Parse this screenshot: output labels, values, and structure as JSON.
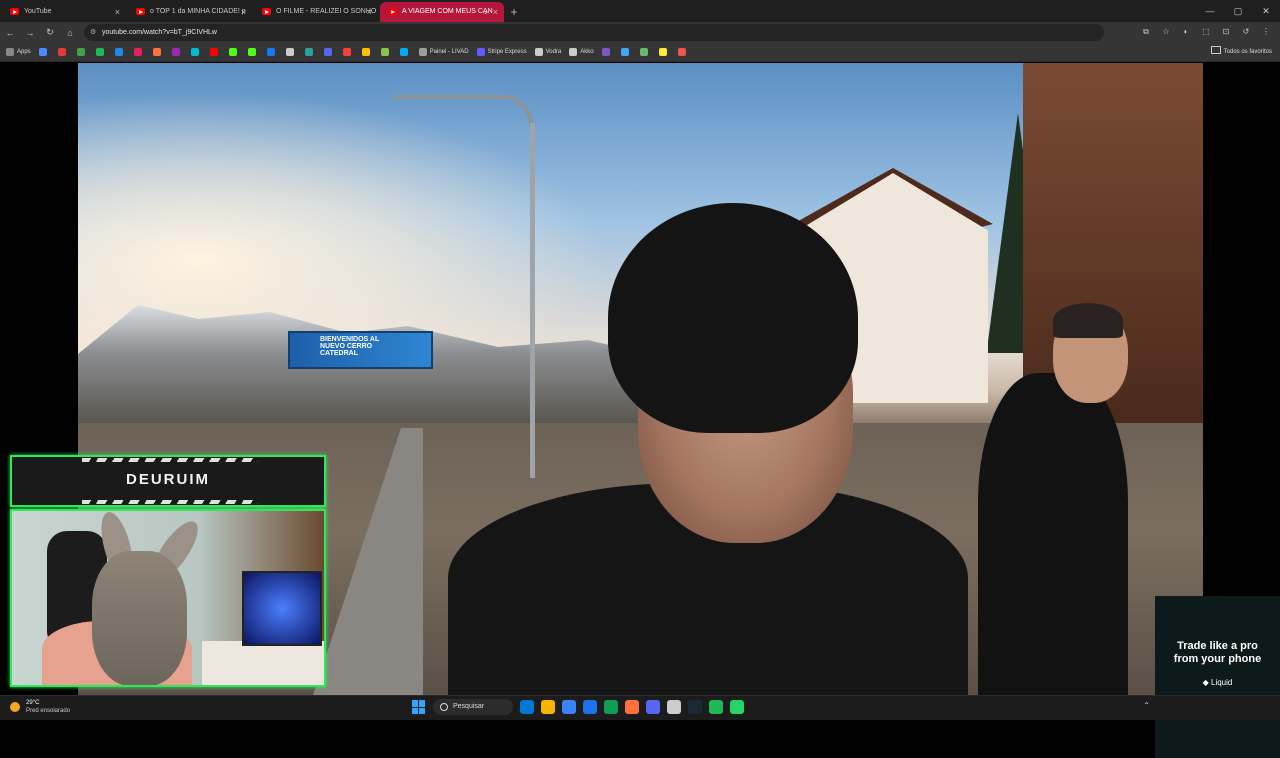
{
  "browser": {
    "tabs": [
      {
        "title": "YouTube",
        "active": false
      },
      {
        "title": "o TOP 1 da MINHA CIDADE! p",
        "active": false
      },
      {
        "title": "O FILME - REALIZEI O SONHO",
        "active": false
      },
      {
        "title": "A VIAGEM COM MEUS CAN",
        "active": true
      }
    ],
    "close_glyph": "×",
    "new_tab_glyph": "+",
    "window_controls": [
      "—",
      "▢",
      "✕"
    ],
    "url": "youtube.com/watch?v=bT_j9CIVHLw",
    "nav": [
      "←",
      "→",
      "↻",
      "⌂"
    ],
    "toolbar_icons": [
      "⧉",
      "☆",
      "◐",
      "⬚",
      "⊡",
      "↺",
      "⋮"
    ],
    "bookmarks": [
      {
        "label": "Apps",
        "color": "#888888"
      },
      {
        "label": "",
        "color": "#4a8cff"
      },
      {
        "label": "",
        "color": "#e53935"
      },
      {
        "label": "",
        "color": "#43a047"
      },
      {
        "label": "",
        "color": "#1db954"
      },
      {
        "label": "",
        "color": "#1e88e5"
      },
      {
        "label": "",
        "color": "#e91e63"
      },
      {
        "label": "",
        "color": "#ff7043"
      },
      {
        "label": "",
        "color": "#9c27b0"
      },
      {
        "label": "",
        "color": "#00bcd4"
      },
      {
        "label": "",
        "color": "#ff0000"
      },
      {
        "label": "",
        "color": "#53fc18"
      },
      {
        "label": "",
        "color": "#53fc18"
      },
      {
        "label": "",
        "color": "#1877f2"
      },
      {
        "label": "",
        "color": "#cccccc"
      },
      {
        "label": "",
        "color": "#26a69a"
      },
      {
        "label": "",
        "color": "#5865f2"
      },
      {
        "label": "",
        "color": "#f44336"
      },
      {
        "label": "",
        "color": "#ffc107"
      },
      {
        "label": "",
        "color": "#8bc34a"
      },
      {
        "label": "",
        "color": "#03a9f4"
      },
      {
        "label": "Painel - LIVAD",
        "color": "#9e9e9e"
      },
      {
        "label": "Stripe Express",
        "color": "#635bff"
      },
      {
        "label": "Vodra",
        "color": "#cccccc"
      },
      {
        "label": "Akko",
        "color": "#cccccc"
      },
      {
        "label": "",
        "color": "#7e57c2"
      },
      {
        "label": "",
        "color": "#42a5f5"
      },
      {
        "label": "",
        "color": "#66bb6a"
      },
      {
        "label": "",
        "color": "#ffeb3b"
      },
      {
        "label": "",
        "color": "#ef5350"
      }
    ],
    "bookmarks_folder": "Todos os favoritos"
  },
  "video": {
    "billboard_text": "BIENVENIDOS AL NUEVO CERRO CATEDRAL",
    "streamer_name": "DEURUIM"
  },
  "ad": {
    "headline": "Trade like a pro from your phone",
    "brand": "◆ Liquid"
  },
  "taskbar": {
    "temperature": "29°C",
    "weather": "Pred ensolarado",
    "search_placeholder": "Pesquisar",
    "apps": [
      "#0078d4",
      "#f4b400",
      "#3b82f6",
      "#1a73e8",
      "#0f9d58",
      "#ff7139",
      "#5865f2",
      "#cccccc",
      "#1b2838",
      "#1db954",
      "#25d366"
    ],
    "tray": "⌃"
  }
}
